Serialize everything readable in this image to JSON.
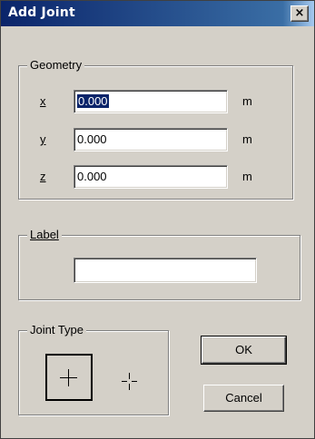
{
  "window": {
    "title": "Add Joint",
    "close_glyph": "×"
  },
  "geometry": {
    "label": "Geometry",
    "rows": [
      {
        "axis": "x",
        "value": "0.000",
        "unit": "m",
        "selected": true
      },
      {
        "axis": "y",
        "value": "0.000",
        "unit": "m",
        "selected": false
      },
      {
        "axis": "z",
        "value": "0.000",
        "unit": "m",
        "selected": false
      }
    ]
  },
  "label_group": {
    "label": "Label",
    "value": ""
  },
  "joint_type": {
    "label": "Joint Type",
    "options": [
      {
        "icon": "joint-type-large-cross-icon",
        "selected": true
      },
      {
        "icon": "joint-type-small-cross-icon",
        "selected": false
      }
    ]
  },
  "buttons": {
    "ok": "OK",
    "cancel": "Cancel"
  },
  "colors": {
    "titlebar": "#0a246a",
    "face": "#d4d0c8",
    "selection": "#0a246a"
  }
}
